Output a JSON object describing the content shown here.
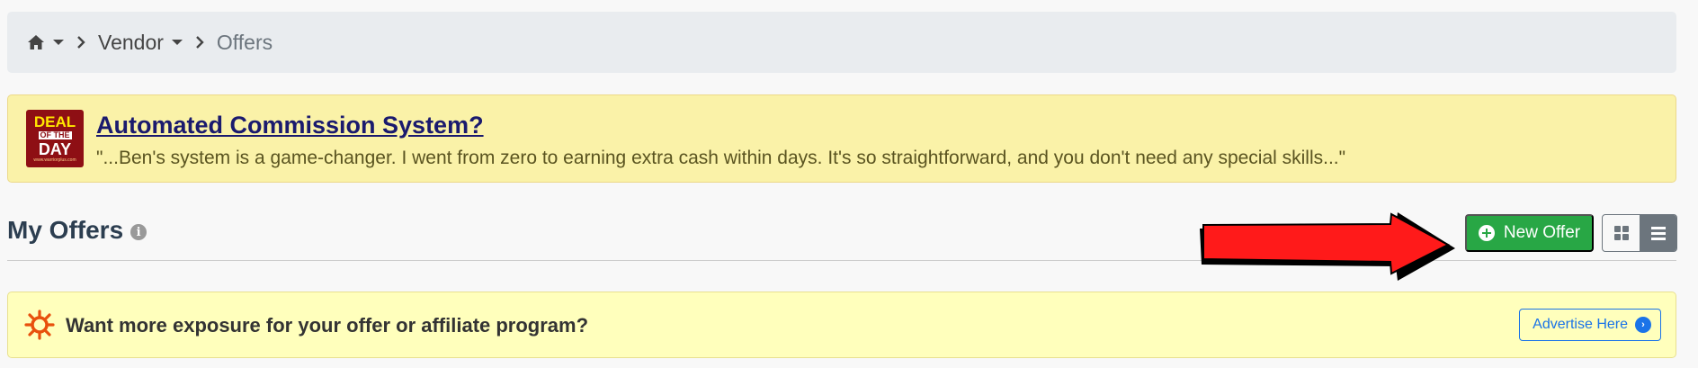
{
  "breadcrumb": {
    "home_icon": "home-icon",
    "vendor_label": "Vendor",
    "current_label": "Offers"
  },
  "deal": {
    "logo_line1": "DEAL",
    "logo_line2": "OF THE",
    "logo_line3": "DAY",
    "logo_line4": "www.warriorplus.com",
    "title": "Automated Commission System?",
    "quote": "\"...Ben's system is a game-changer. I went from zero to earning extra cash within days. It's so straightforward, and you don't need any special skills...\""
  },
  "offers": {
    "heading": "My Offers",
    "info_icon": "i",
    "new_offer_label": "New Offer"
  },
  "promo": {
    "text": "Want more exposure for your offer or affiliate program?",
    "advertise_label": "Advertise Here",
    "advertise_icon": "›"
  },
  "colors": {
    "accent_green": "#28a745",
    "link_blue": "#1a73e8",
    "arrow_red": "#ff1a1a",
    "deal_bg": "#faf2a8",
    "promo_bg": "#ffffbc"
  }
}
